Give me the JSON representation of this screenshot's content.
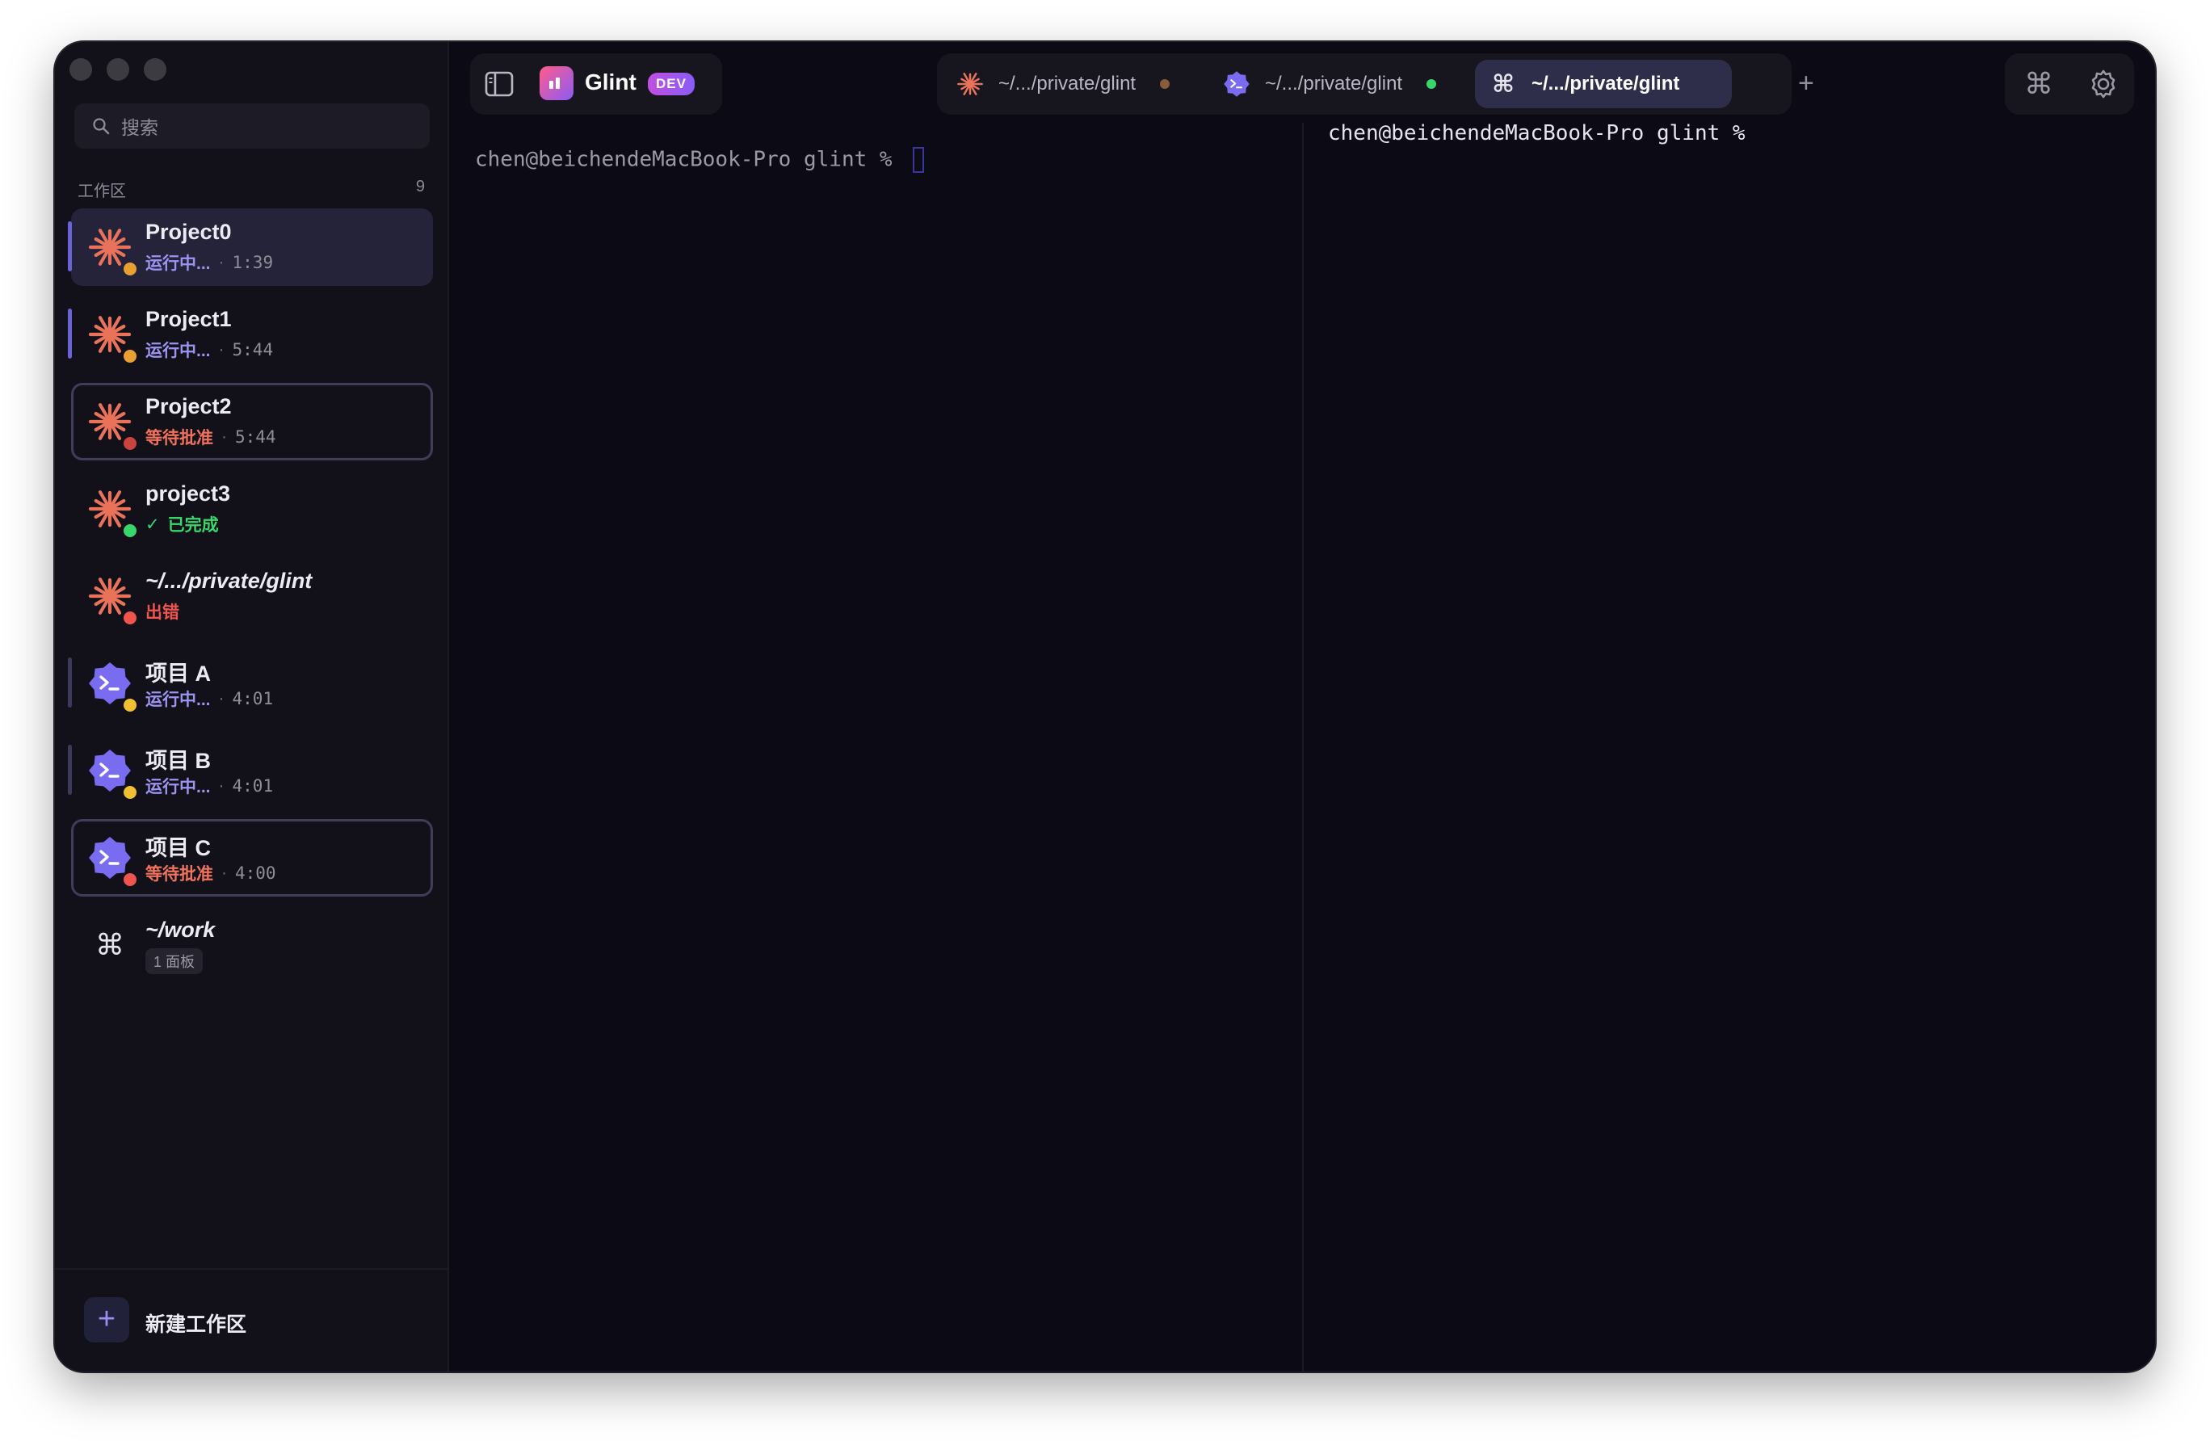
{
  "sidebar": {
    "search_placeholder": "搜索",
    "section_title": "工作区",
    "workspace_count": "9",
    "workspaces": [
      {
        "name": "Project0",
        "status": "运行中...",
        "time": "1:39",
        "kind": "claude",
        "state": "running",
        "dot_color": "#f0a030"
      },
      {
        "name": "Project1",
        "status": "运行中...",
        "time": "5:44",
        "kind": "claude",
        "state": "running",
        "dot_color": "#f0a030"
      },
      {
        "name": "Project2",
        "status": "等待批准",
        "time": "5:44",
        "kind": "claude",
        "state": "waiting",
        "dot_color": "#f0544e"
      },
      {
        "name": "project3",
        "status": "已完成",
        "time": "",
        "kind": "claude",
        "state": "done",
        "dot_color": "#38d66b"
      },
      {
        "name": "~/.../private/glint",
        "status": "出错",
        "time": "",
        "kind": "claude",
        "state": "error",
        "dot_color": "#f0544e"
      },
      {
        "name": "项目 A",
        "status": "运行中...",
        "time": "4:01",
        "kind": "codex",
        "state": "running",
        "dot_color": "#f0c030"
      },
      {
        "name": "项目 B",
        "status": "运行中...",
        "time": "4:01",
        "kind": "codex",
        "state": "running",
        "dot_color": "#f0c030"
      },
      {
        "name": "项目 C",
        "status": "等待批准",
        "time": "4:00",
        "kind": "codex",
        "state": "waiting",
        "dot_color": "#f0544e"
      },
      {
        "name": "~/work",
        "status": "1 面板",
        "time": "",
        "kind": "shell",
        "state": "panel",
        "dot_color": ""
      }
    ],
    "new_workspace_label": "新建工作区"
  },
  "topbar": {
    "app_name": "Glint",
    "badge": "DEV",
    "tabs": [
      {
        "label": "~/.../private/glint",
        "icon": "claude-icon",
        "status_color": "#8a5a3a"
      },
      {
        "label": "~/.../private/glint",
        "icon": "codex-icon",
        "status_color": "#38d66b"
      },
      {
        "label": "~/.../private/glint",
        "icon": "command-icon",
        "status_color": ""
      }
    ]
  },
  "terminals": {
    "left_prompt": "chen@beichendeMacBook-Pro glint % ",
    "right_prompt": "chen@beichendeMacBook-Pro glint %"
  },
  "colors": {
    "background": "#0c0b15",
    "sidebar": "#121119",
    "accent": "#6b62d6",
    "claude": "#e9735a",
    "codex": "#7a6cf0"
  }
}
